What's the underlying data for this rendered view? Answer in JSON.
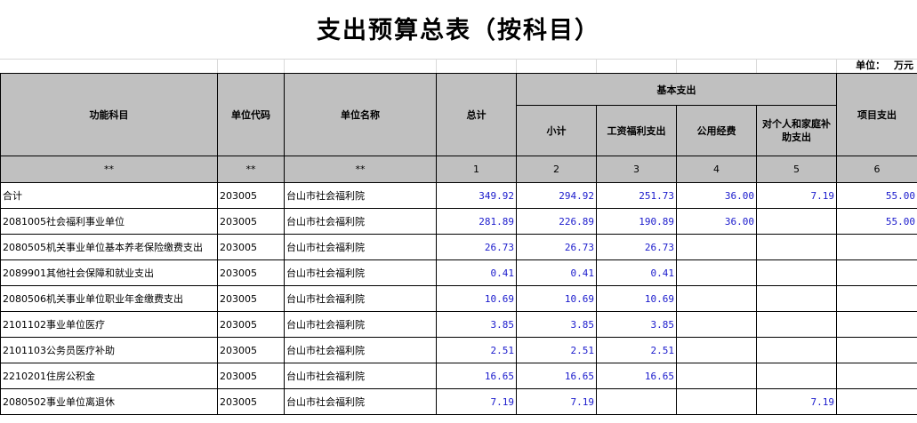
{
  "title": "支出预算总表（按科目）",
  "unit_label": "单位：  万元",
  "headers": {
    "function_subject": "功能科目",
    "unit_code": "单位代码",
    "unit_name": "单位名称",
    "total": "总计",
    "basic": "基本支出",
    "subtotal": "小计",
    "salary": "工资福利支出",
    "public_funds": "公用经费",
    "personal_subsidy": "对个人和家庭补助支出",
    "project": "项目支出"
  },
  "index_row": [
    "**",
    "**",
    "**",
    "1",
    "2",
    "3",
    "4",
    "5",
    "6"
  ],
  "rows": [
    {
      "subject": "合计",
      "code": "203005",
      "name": "台山市社会福利院",
      "total": "349.92",
      "subtotal": "294.92",
      "salary": "251.73",
      "public": "36.00",
      "personal": "7.19",
      "project": "55.00"
    },
    {
      "subject": "2081005社会福利事业单位",
      "code": "203005",
      "name": "台山市社会福利院",
      "total": "281.89",
      "subtotal": "226.89",
      "salary": "190.89",
      "public": "36.00",
      "personal": "",
      "project": "55.00"
    },
    {
      "subject": "2080505机关事业单位基本养老保险缴费支出",
      "code": "203005",
      "name": "台山市社会福利院",
      "total": "26.73",
      "subtotal": "26.73",
      "salary": "26.73",
      "public": "",
      "personal": "",
      "project": ""
    },
    {
      "subject": "2089901其他社会保障和就业支出",
      "code": "203005",
      "name": "台山市社会福利院",
      "total": "0.41",
      "subtotal": "0.41",
      "salary": "0.41",
      "public": "",
      "personal": "",
      "project": ""
    },
    {
      "subject": "2080506机关事业单位职业年金缴费支出",
      "code": "203005",
      "name": "台山市社会福利院",
      "total": "10.69",
      "subtotal": "10.69",
      "salary": "10.69",
      "public": "",
      "personal": "",
      "project": ""
    },
    {
      "subject": "2101102事业单位医疗",
      "code": "203005",
      "name": "台山市社会福利院",
      "total": "3.85",
      "subtotal": "3.85",
      "salary": "3.85",
      "public": "",
      "personal": "",
      "project": ""
    },
    {
      "subject": "2101103公务员医疗补助",
      "code": "203005",
      "name": "台山市社会福利院",
      "total": "2.51",
      "subtotal": "2.51",
      "salary": "2.51",
      "public": "",
      "personal": "",
      "project": ""
    },
    {
      "subject": "2210201住房公积金",
      "code": "203005",
      "name": "台山市社会福利院",
      "total": "16.65",
      "subtotal": "16.65",
      "salary": "16.65",
      "public": "",
      "personal": "",
      "project": ""
    },
    {
      "subject": "2080502事业单位离退休",
      "code": "203005",
      "name": "台山市社会福利院",
      "total": "7.19",
      "subtotal": "7.19",
      "salary": "",
      "public": "",
      "personal": "7.19",
      "project": ""
    }
  ]
}
